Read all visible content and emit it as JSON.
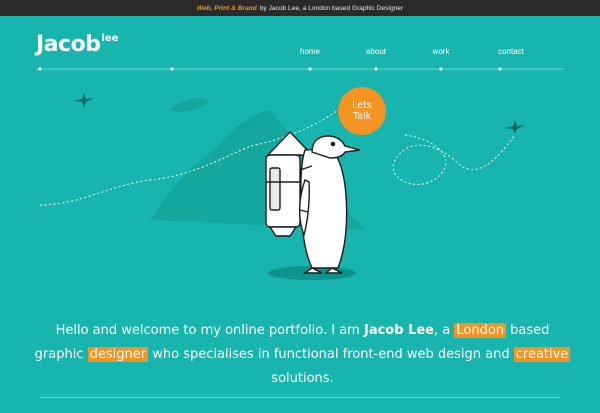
{
  "topbar": {
    "highlight": "Web, Print & Brand",
    "text": "by Jacob Lee, a London based Graphic Designer"
  },
  "logo": {
    "main": "Jacob",
    "sup": "lee"
  },
  "nav": {
    "items": [
      {
        "label": "home"
      },
      {
        "label": "about"
      },
      {
        "label": "work"
      },
      {
        "label": "contact"
      }
    ]
  },
  "bubble": {
    "line1": "Lets",
    "line2": "Talk"
  },
  "intro": {
    "part1": "Hello and welcome to my online portfolio. I am ",
    "name": "Jacob Lee",
    "part2": ", a ",
    "city": "London",
    "part3": " based graphic ",
    "role": "designer",
    "part4": " who specialises in functional front-end web design and ",
    "trait": "creative",
    "part5": " solutions."
  },
  "colors": {
    "background": "#17b5ad",
    "accent": "#f39322",
    "topbar": "#2a2a2a",
    "text": "#ffffff"
  },
  "icons": [
    "bird-icon",
    "mountain-illustration",
    "penguin-illustration",
    "dotted-flight-path-icon"
  ]
}
